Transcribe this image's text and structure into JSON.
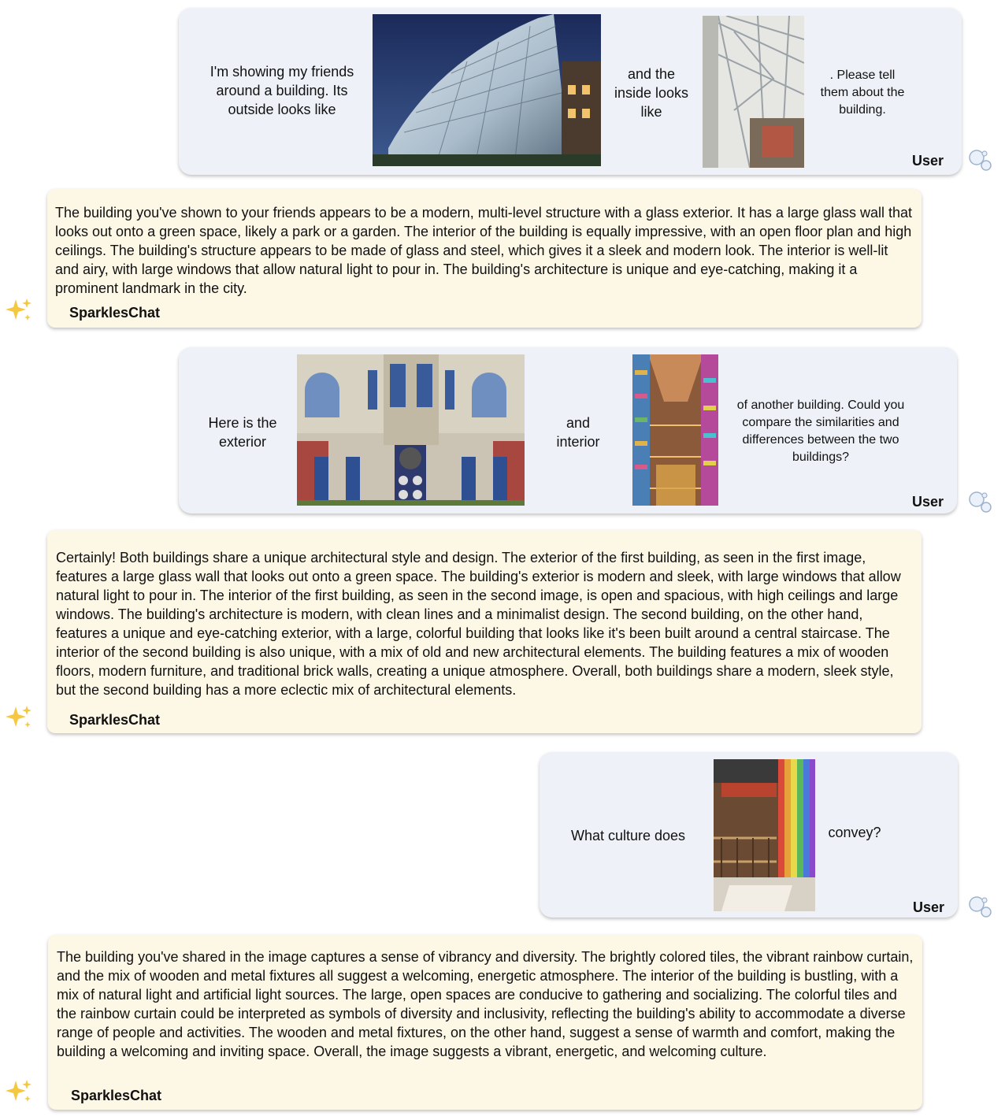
{
  "turns": [
    {
      "role": "User",
      "segments": [
        "I'm showing my friends around a building. Its outside looks like",
        "and the inside looks like",
        ". Please tell them about the building."
      ],
      "images": [
        "glass-building-exterior",
        "glass-building-interior"
      ]
    },
    {
      "role": "SparklesChat",
      "text": "The building you've shown to your friends appears to be a modern, multi-level structure with a glass exterior. It has a large glass wall that looks out onto a green space, likely a park or a garden. The interior of the building is equally impressive, with an open floor plan and high ceilings. The building's structure appears to be made of glass and steel, which gives it a sleek and modern look. The interior is well-lit and airy, with large windows that allow natural light to pour in. The building's architecture is unique and eye-catching, making it a prominent landmark in the city."
    },
    {
      "role": "User",
      "segments": [
        "Here is the exterior",
        "and interior",
        "of another building. Could you compare the similarities and differences between the two buildings?"
      ],
      "images": [
        "brick-building-exterior",
        "colorful-atrium-interior"
      ]
    },
    {
      "role": "SparklesChat",
      "text": "Certainly! Both buildings share a unique architectural style and design. The exterior of the first building, as seen in the first image, features a large glass wall that looks out onto a green space. The building's exterior is modern and sleek, with large windows that allow natural light to pour in. The interior of the first building, as seen in the second image, is open and spacious, with high ceilings and large windows. The building's architecture is modern, with clean lines and a minimalist design. The second building, on the other hand, features a unique and eye-catching exterior, with a large, colorful building that looks like it's been built around a central staircase. The interior of the second building is also unique, with a mix of old and new architectural elements. The building features a mix of wooden floors, modern furniture, and traditional brick walls, creating a unique atmosphere. Overall, both buildings share a modern, sleek style, but the second building has a more eclectic mix of architectural elements."
    },
    {
      "role": "User",
      "segments": [
        "What culture does",
        "convey?"
      ],
      "images": [
        "rainbow-curtain-interior"
      ]
    },
    {
      "role": "SparklesChat",
      "text": "The building you've shared in the image captures a sense of vibrancy and diversity. The brightly colored tiles, the vibrant rainbow curtain, and the mix of wooden and metal fixtures all suggest a welcoming, energetic atmosphere. The interior of the building is bustling, with a mix of natural light and artificial light sources. The large, open spaces are conducive to gathering and socializing. The colorful tiles and the rainbow curtain could be interpreted as symbols of diversity and inclusivity, reflecting the building's ability to accommodate a diverse range of people and activities. The wooden and metal fixtures, on the other hand, suggest a sense of warmth and comfort, making the building a welcoming and inviting space. Overall, the image suggests a vibrant, energetic, and welcoming culture."
    }
  ],
  "icons": {
    "user_avatar": "bubbles-icon",
    "bot_avatar": "sparkles-icon"
  }
}
